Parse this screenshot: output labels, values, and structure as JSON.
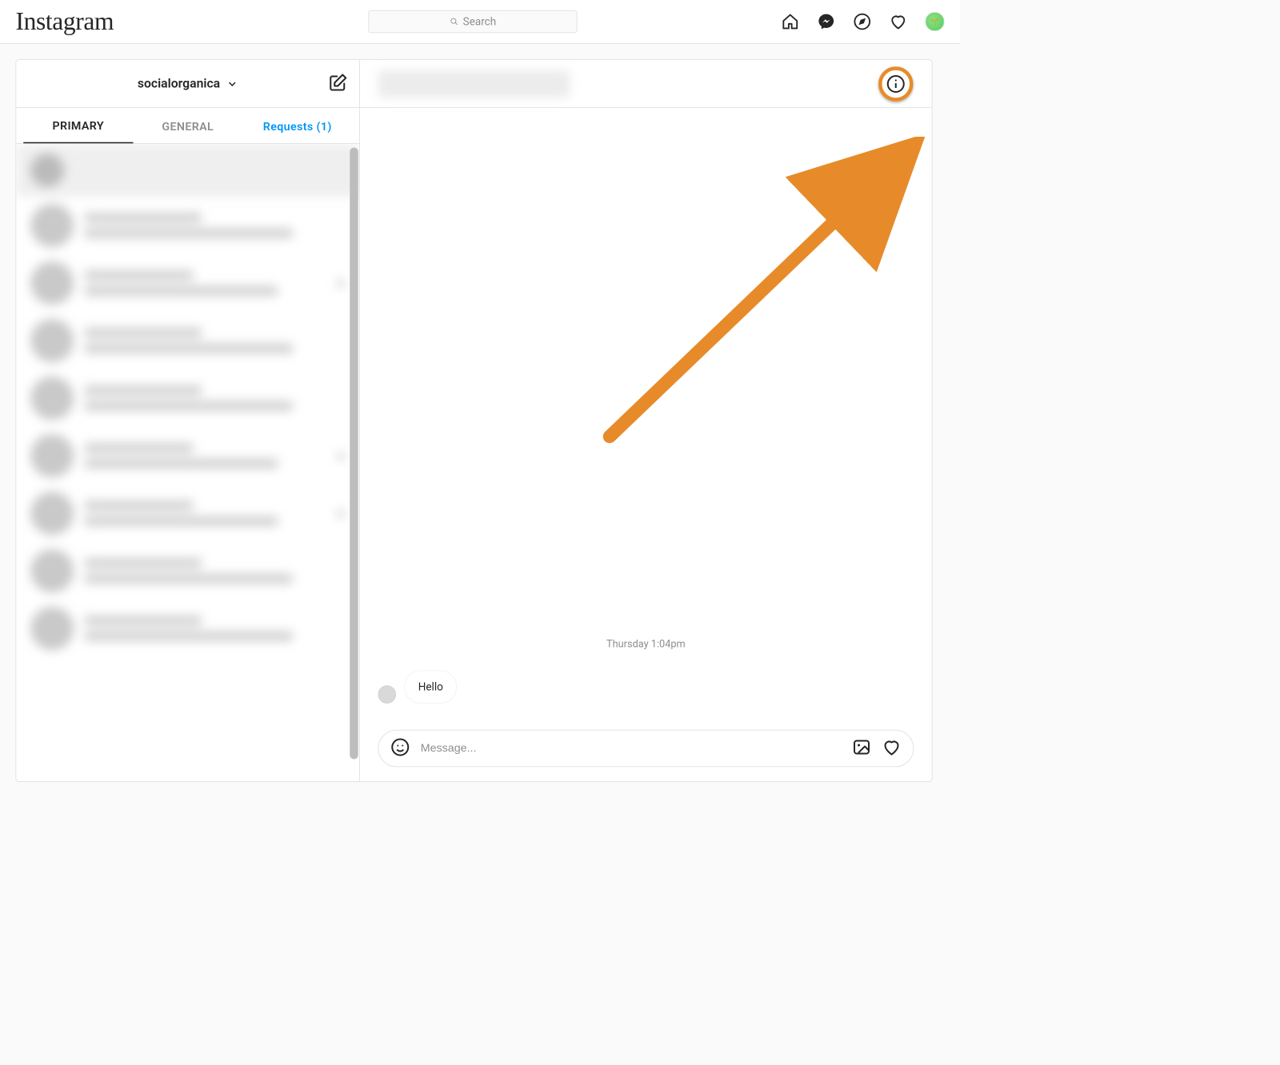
{
  "brand": "Instagram",
  "search": {
    "placeholder": "Search"
  },
  "nav": {
    "home": "home",
    "messenger": "messenger",
    "explore": "explore",
    "activity": "activity",
    "profile": "profile"
  },
  "sidebar": {
    "account": "socialorganica",
    "tabs": {
      "primary": "PRIMARY",
      "general": "GENERAL",
      "requests": "Requests (1)"
    }
  },
  "chat": {
    "timestamp": "Thursday 1:04pm",
    "messages": [
      {
        "text": "Hello"
      }
    ],
    "composer_placeholder": "Message..."
  },
  "annotation": {
    "color": "#e78b2a",
    "target": "info-icon"
  }
}
